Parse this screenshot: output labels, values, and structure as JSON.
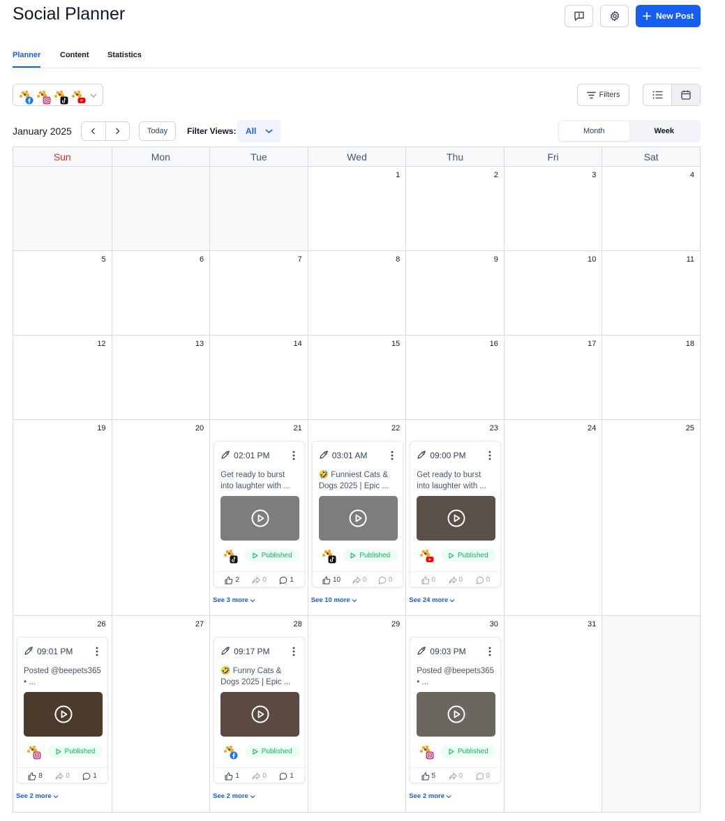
{
  "header": {
    "title": "Social Planner",
    "new_post_label": "New Post"
  },
  "tabs": [
    {
      "label": "Planner",
      "active": true
    },
    {
      "label": "Content",
      "active": false
    },
    {
      "label": "Statistics",
      "active": false
    }
  ],
  "toolbar": {
    "filters_label": "Filters",
    "month_label": "January 2025",
    "today_label": "Today",
    "filter_views_label": "Filter Views:",
    "filter_views_value": "All",
    "view_month": "Month",
    "view_week": "Week"
  },
  "accounts": [
    {
      "platform": "facebook",
      "color": "#1877f2"
    },
    {
      "platform": "instagram",
      "color": "#e1306c"
    },
    {
      "platform": "tiktok",
      "color": "#111111"
    },
    {
      "platform": "youtube",
      "color": "#ff0000"
    }
  ],
  "calendar": {
    "weekdays": [
      "Sun",
      "Mon",
      "Tue",
      "Wed",
      "Thu",
      "Fri",
      "Sat"
    ],
    "weeks": [
      {
        "days": [
          "",
          "",
          "",
          "1",
          "2",
          "3",
          "4"
        ]
      },
      {
        "days": [
          "5",
          "6",
          "7",
          "8",
          "9",
          "10",
          "11"
        ]
      },
      {
        "days": [
          "12",
          "13",
          "14",
          "15",
          "16",
          "17",
          "18"
        ]
      },
      {
        "days": [
          "19",
          "20",
          "21",
          "22",
          "23",
          "24",
          "25"
        ]
      },
      {
        "days": [
          "26",
          "27",
          "28",
          "29",
          "30",
          "31",
          ""
        ]
      }
    ]
  },
  "posts": [
    {
      "time": "02:01 PM",
      "text": "Get ready to burst into laughter with ...",
      "platform": "tiktok",
      "status": "Published",
      "likes": "2",
      "shares": "0",
      "comments": "1",
      "see_more": "See 3 more",
      "thumb": "#7d7d7d"
    },
    {
      "time": "03:01 AM",
      "text": "🤣 Funniest Cats & Dogs 2025 | Epic ...",
      "platform": "tiktok",
      "status": "Published",
      "likes": "10",
      "shares": "0",
      "comments": "0",
      "see_more": "See 10 more",
      "thumb": "#7d7d7d"
    },
    {
      "time": "09:00 PM",
      "text": "Get ready to burst into laughter with ...",
      "platform": "youtube",
      "status": "Published",
      "likes": "0",
      "shares": "0",
      "comments": "0",
      "see_more": "See 24 more",
      "thumb": "#5b5047"
    },
    {
      "time": "09:01 PM",
      "text": "Posted @beepets365 • ...",
      "platform": "instagram",
      "status": "Published",
      "likes": "8",
      "shares": "0",
      "comments": "1",
      "see_more": "See 2 more",
      "thumb": "#4a3b2a"
    },
    {
      "time": "09:17 PM",
      "text": "🤣 Funny Cats & Dogs 2025 | Epic ...",
      "platform": "facebook",
      "status": "Published",
      "likes": "1",
      "shares": "0",
      "comments": "1",
      "see_more": "See 2 more",
      "thumb": "#5a4a42"
    },
    {
      "time": "09:03 PM",
      "text": "Posted @beepets365 • ...",
      "platform": "instagram",
      "status": "Published",
      "likes": "5",
      "shares": "0",
      "comments": "0",
      "see_more": "See 2 more",
      "thumb": "#6b665f"
    }
  ],
  "colors": {
    "accent": "#155eef",
    "published_text": "#12b76a",
    "published_bg": "#ecfdf3",
    "sunday": "#d92d20"
  }
}
